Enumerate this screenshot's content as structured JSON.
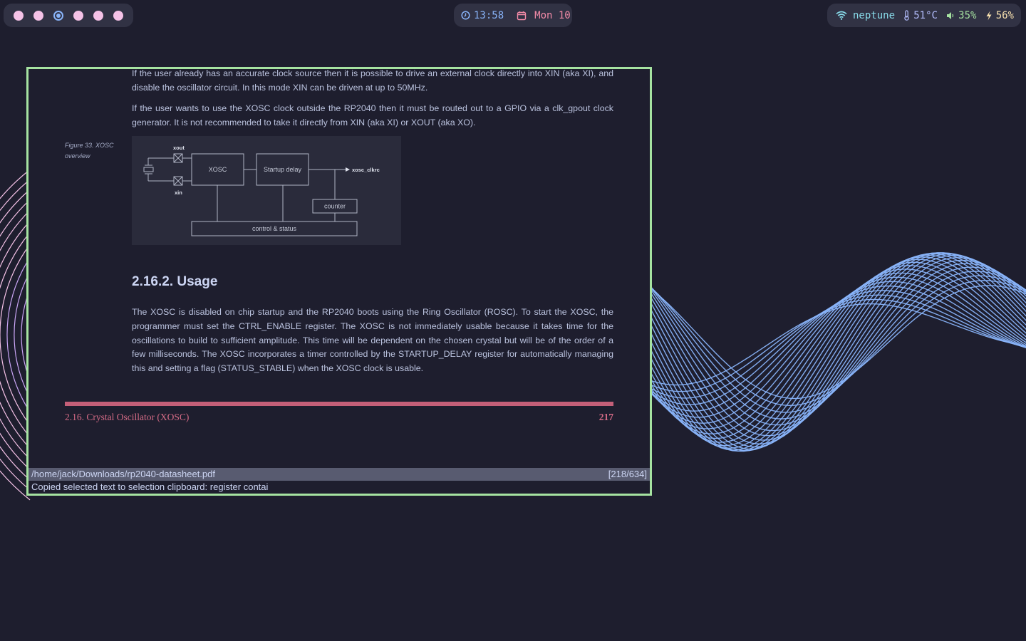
{
  "topbar": {
    "workspaces": [
      {
        "name": "workspace-1",
        "active": false
      },
      {
        "name": "workspace-2",
        "active": false
      },
      {
        "name": "workspace-3",
        "active": true
      },
      {
        "name": "workspace-4",
        "active": false
      },
      {
        "name": "workspace-5",
        "active": false
      },
      {
        "name": "workspace-6",
        "active": false
      }
    ],
    "clock": {
      "icon": "clock-icon",
      "time": "13:58",
      "calendar_icon": "calendar-icon",
      "date": "Mon 10"
    },
    "status": {
      "wifi_icon": "wifi-icon",
      "network": "neptune",
      "temp_icon": "thermometer-icon",
      "temperature": "51°C",
      "volume_icon": "speaker-icon",
      "volume": "35%",
      "battery_icon": "bolt-icon",
      "battery": "56%"
    }
  },
  "colors": {
    "background": "#1e1e2e",
    "bar": "#313244",
    "window_border": "#a6e3a1",
    "accent_pink": "#f5c2e7",
    "accent_blue": "#89b4fa",
    "footer_red": "#d56b86",
    "wave_blue": "#89b4fa",
    "wave_pink": "#f5c2e7"
  },
  "document": {
    "para1": "If the user already has an accurate clock source then it is possible to drive an external clock directly into XIN (aka XI), and disable the oscillator circuit. In this mode XIN can be driven at up to 50MHz.",
    "para2": "If the user wants to use the XOSC clock outside the RP2040 then it must be routed out to a GPIO via a clk_gpout clock generator. It is not recommended to take it directly from XIN (aka XI) or XOUT (aka XO).",
    "figure_caption": "Figure 33. XOSC overview",
    "figure": {
      "xout": "xout",
      "xin": "xin",
      "xosc": "XOSC",
      "startup_delay": "Startup delay",
      "output": "xosc_clkrc",
      "counter": "counter",
      "control_status": "control & status"
    },
    "section_title": "2.16.2. Usage",
    "para3": "The XOSC is disabled on chip startup and the RP2040 boots using the Ring Oscillator (ROSC). To start the XOSC, the programmer must set the CTRL_ENABLE register. The XOSC is not immediately usable because it takes time for the oscillations to build to sufficient amplitude. This time will be dependent on the chosen crystal but will be of the order of a few milliseconds. The XOSC incorporates a timer controlled by the STARTUP_DELAY register for automatically managing this and setting a flag (STATUS_STABLE) when the XOSC clock is usable.",
    "footer_section": "2.16. Crystal Oscillator (XOSC)",
    "footer_page": "217"
  },
  "viewer": {
    "file_path": "/home/jack/Downloads/rp2040-datasheet.pdf",
    "page_indicator": "[218/634]",
    "notification": "Copied selected text to selection clipboard: register contai"
  }
}
